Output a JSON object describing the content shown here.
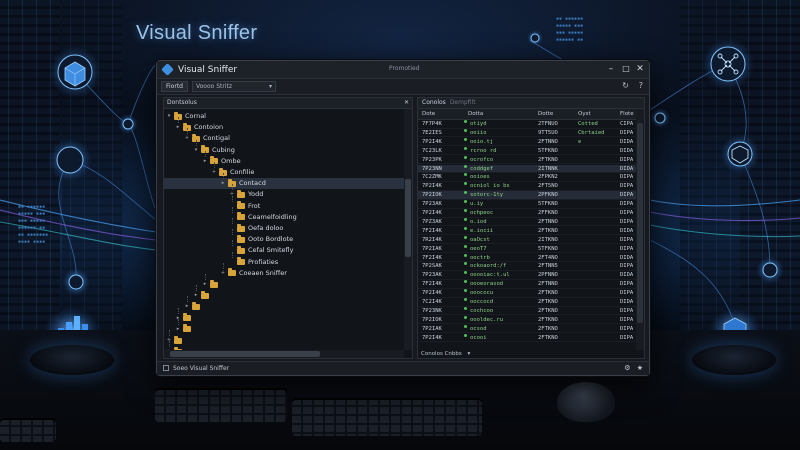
{
  "hero": {
    "title": "Visual Sniffer"
  },
  "window": {
    "title": "Visual Sniffer",
    "subtitle": "Promotied",
    "controls": {
      "minimize": "–",
      "maximize": "□",
      "close": "✕"
    }
  },
  "toolbar": {
    "button_label": "Fiortd",
    "select_value": "Voooo Stritz",
    "icons": [
      "refresh-icon",
      "help-icon"
    ]
  },
  "tree": {
    "header": "Dontsolus",
    "header_close": "✕",
    "nodes": [
      {
        "label": "Cornal",
        "depth": 0,
        "twisty": "▾"
      },
      {
        "label": "Contoion",
        "depth": 1,
        "twisty": "▸"
      },
      {
        "label": "Contigal",
        "depth": 2,
        "twisty": "+"
      },
      {
        "label": "Cubing",
        "depth": 3,
        "twisty": "▾"
      },
      {
        "label": "Ombe",
        "depth": 4,
        "twisty": "▸"
      },
      {
        "label": "Confilie",
        "depth": 5,
        "twisty": "+"
      },
      {
        "label": "Contacd",
        "depth": 6,
        "twisty": "▸",
        "selected": true
      },
      {
        "label": "Yodd",
        "depth": 7,
        "twisty": "+"
      },
      {
        "label": "Frot",
        "depth": 7,
        "twisty": ""
      },
      {
        "label": "Ceamelfoidling",
        "depth": 7,
        "twisty": ""
      },
      {
        "label": "Oefa doloo",
        "depth": 7,
        "twisty": ""
      },
      {
        "label": "Ooto Bordlote",
        "depth": 7,
        "twisty": ""
      },
      {
        "label": "Cefal Smitefly",
        "depth": 7,
        "twisty": ""
      },
      {
        "label": "Profiaties",
        "depth": 7,
        "twisty": ""
      },
      {
        "label": "Coeaen Sniffer",
        "depth": 6,
        "twisty": "+"
      },
      {
        "label": "",
        "depth": 4,
        "twisty": "▸"
      },
      {
        "label": "",
        "depth": 3,
        "twisty": "▸"
      },
      {
        "label": "",
        "depth": 2,
        "twisty": "▸"
      },
      {
        "label": "",
        "depth": 1,
        "twisty": "▸"
      },
      {
        "label": "",
        "depth": 1,
        "twisty": "▸"
      },
      {
        "label": "",
        "depth": 0,
        "twisty": "+"
      },
      {
        "label": "",
        "depth": 0,
        "twisty": "▸"
      }
    ]
  },
  "table": {
    "tabs": [
      "Conolos",
      "Dempfilt"
    ],
    "columns": [
      "Dote",
      "Dotta",
      "Dotte",
      "Oyst",
      "Flote"
    ],
    "rows": [
      [
        "7F7P4K",
        "otiyd",
        "2TFNUO",
        "Cotted",
        "CIPA"
      ],
      [
        "7E2IES",
        "ooiio",
        "9TT5UO",
        "Cbrtaied",
        "DIPA"
      ],
      [
        "7P2I4K",
        "ooio.tj",
        "2FTNNO",
        "⊙",
        "DIDA"
      ],
      [
        "7C23LK",
        "rcroo rd",
        "5TFKNO",
        "",
        "DIDA"
      ],
      [
        "7P23PK",
        "ocrofco",
        "2FTKNO",
        "",
        "DIPA"
      ],
      [
        "7P23NN",
        "coddgef",
        "2ITNNK",
        "",
        "DIDA"
      ],
      [
        "7C2ZMK",
        "ooioes",
        "2FPKN2",
        "",
        "DIPA"
      ],
      [
        "7P2I4K",
        "ocniol io bs",
        "2FT5NO",
        "",
        "DIPA"
      ],
      [
        "7P2IOK",
        "sotorc-1ty",
        "2PFKNO",
        "",
        "DIPA"
      ],
      [
        "7P23AK",
        "u.iy",
        "5TFKNO",
        "",
        "DIPA"
      ],
      [
        "7P2I4K",
        "ochpeoc",
        "2FFKNO",
        "",
        "DIPA"
      ],
      [
        "7PZ3AK",
        "o.iod",
        "2FTNNO",
        "",
        "DIPA"
      ],
      [
        "7F2I4K",
        "e.iocii",
        "2FTKNO",
        "",
        "DIDA"
      ],
      [
        "7R2I4K",
        "oaOcst",
        "2ITKNO",
        "",
        "DIPA"
      ],
      [
        "7P2IAK",
        "oeoT7",
        "5TFKNO",
        "",
        "DIPA"
      ],
      [
        "7F2I4K",
        "ooctrb",
        "2FT4NO",
        "",
        "DIDA"
      ],
      [
        "7P2SAK",
        "ockoaord:/f",
        "2FTNN5",
        "",
        "DIPA"
      ],
      [
        "7P23AK",
        "ooooiac:t.ul",
        "2PFNNO",
        "",
        "DIDA"
      ],
      [
        "7F2I4K",
        "oooeorasod",
        "2FTNNO",
        "",
        "DIPA"
      ],
      [
        "7P2I4K",
        "ooococu",
        "2FTKNO",
        "",
        "DIPA"
      ],
      [
        "7C2I4K",
        "ooccocd",
        "2FTKNO",
        "",
        "DIDA"
      ],
      [
        "7P23NK",
        "cochcoo",
        "2FTKNO",
        "",
        "DIPA"
      ],
      [
        "7P2IOK",
        "oooldec.ru",
        "2FTKNO",
        "",
        "DIPA"
      ],
      [
        "7P2IAK",
        "ocsod",
        "2FTKNO",
        "",
        "DIPA"
      ],
      [
        "7P2I4K",
        "ocooi",
        "2FTKNO",
        "",
        "DIPA"
      ]
    ],
    "footer": "Conolos Cnbbs"
  },
  "status": {
    "label": "Soeo Visual Sniffer",
    "right_icons": [
      "settings-icon",
      "star-icon"
    ]
  },
  "colors": {
    "accent": "#3d8fe0",
    "folder": "#d8a43a",
    "ok_green": "#8fd18a"
  }
}
